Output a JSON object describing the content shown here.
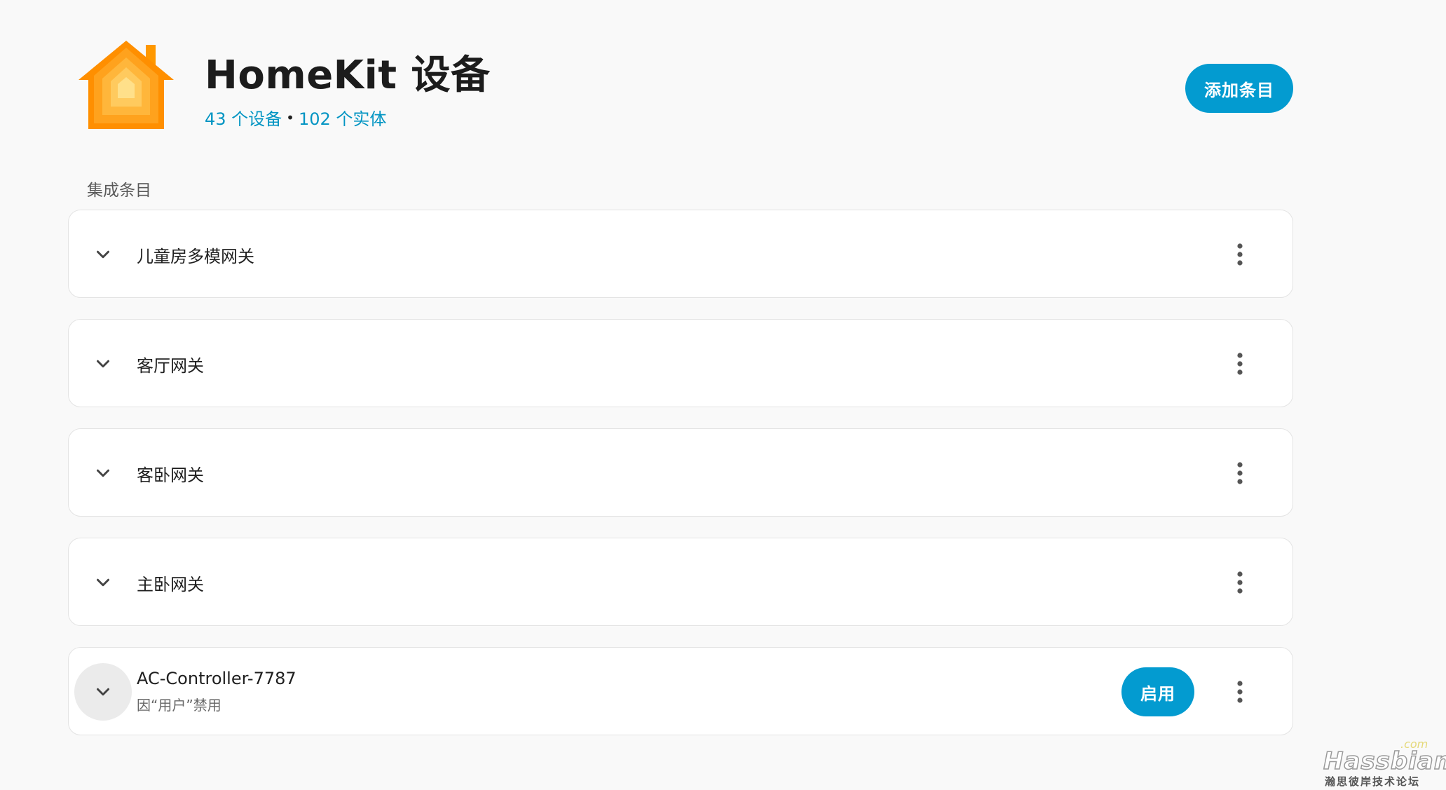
{
  "header": {
    "title": "HomeKit 设备",
    "devices_count": "43 个设备",
    "separator": "•",
    "entities_count": "102 个实体",
    "add_button_label": "添加条目",
    "logo_icon": "homekit-house-icon",
    "logo_colors": [
      "#ff8c00",
      "#ffa726",
      "#ffc14d",
      "#ffe08a"
    ]
  },
  "section": {
    "label": "集成条目"
  },
  "entries": [
    {
      "title": "儿童房多模网关",
      "subtitle": "",
      "disabled": false
    },
    {
      "title": "客厅网关",
      "subtitle": "",
      "disabled": false
    },
    {
      "title": "客卧网关",
      "subtitle": "",
      "disabled": false
    },
    {
      "title": "主卧网关",
      "subtitle": "",
      "disabled": false
    },
    {
      "title": "AC-Controller-7787",
      "subtitle": "因“用户”禁用",
      "disabled": true,
      "enable_label": "启用"
    }
  ],
  "icons": {
    "expand": "chevron-down-icon",
    "menu": "more-vertical-icon"
  },
  "colors": {
    "accent": "#039bd0",
    "link": "#0395c3",
    "background": "#f9f9f9"
  },
  "watermark": {
    "main": "Hassbian",
    "suffix": ".com",
    "caption": "瀚思彼岸技术论坛"
  }
}
